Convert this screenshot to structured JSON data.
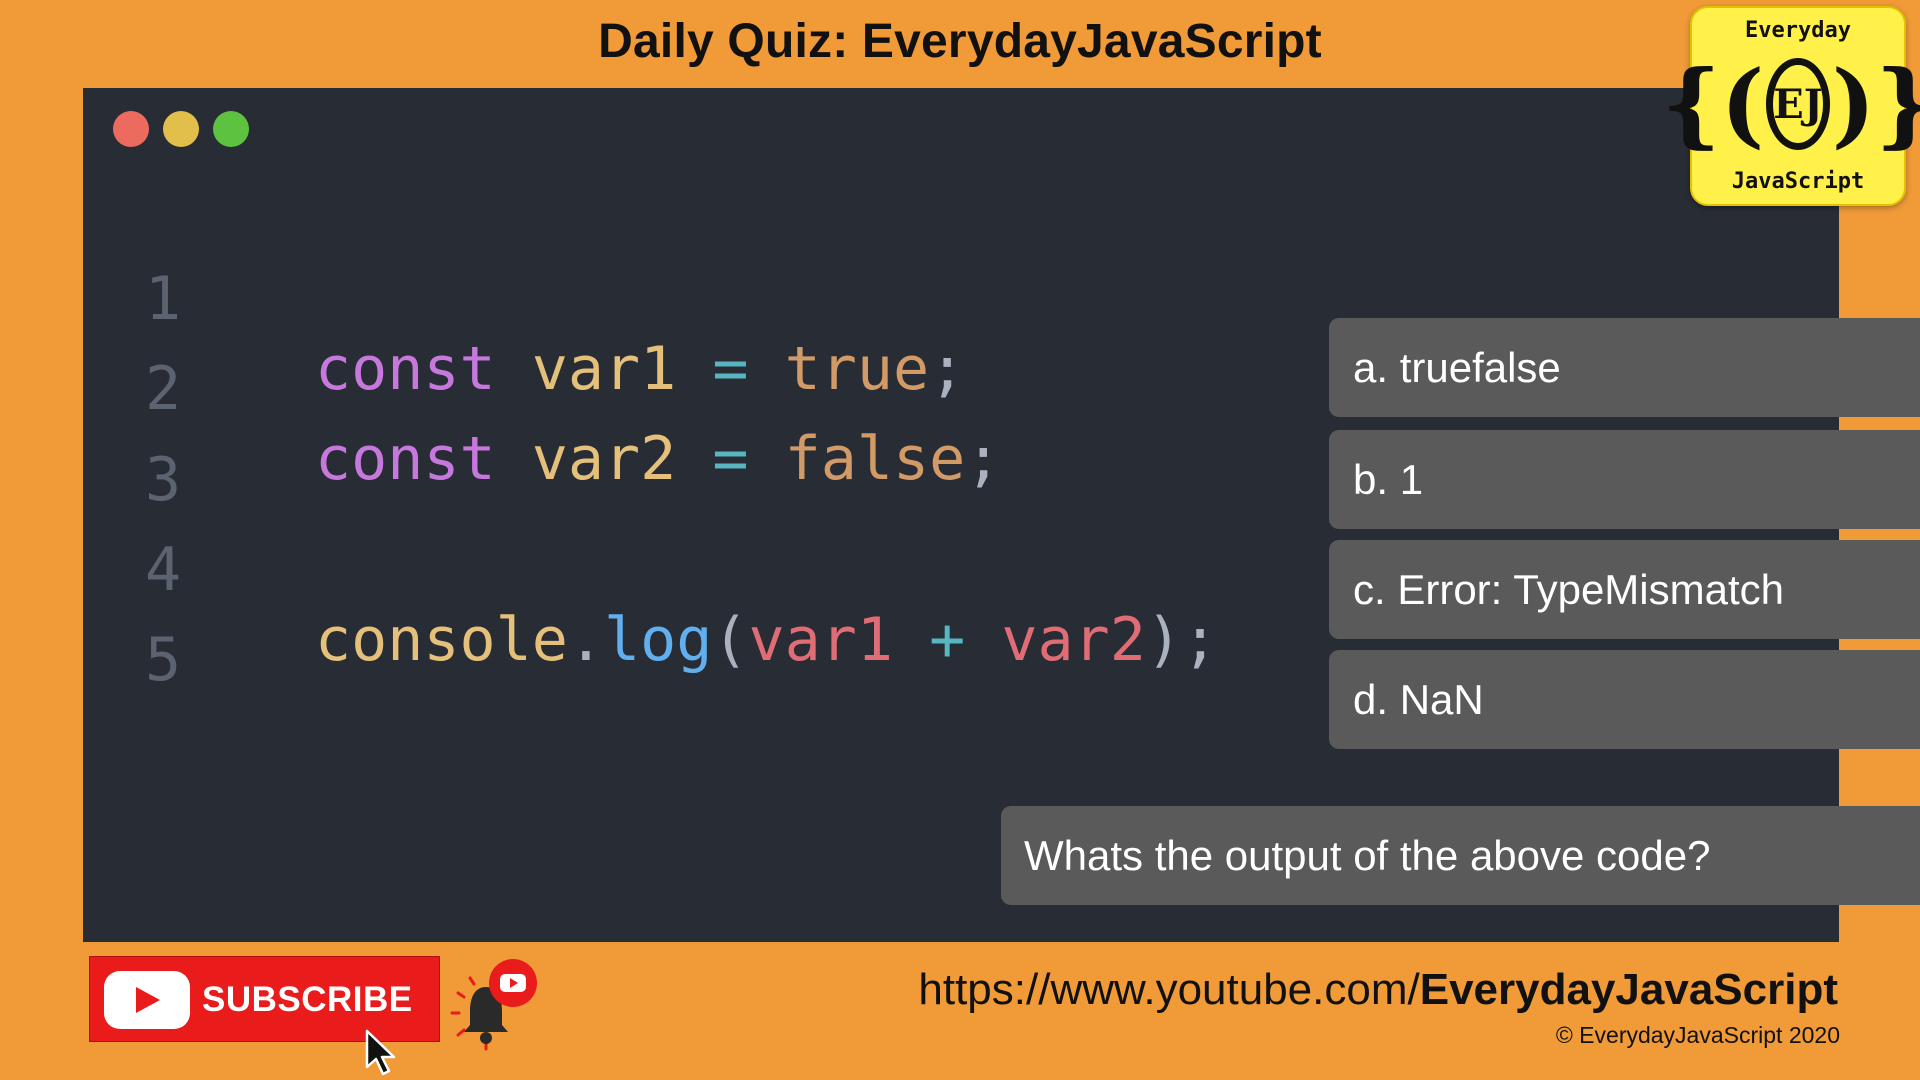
{
  "header": {
    "title": "Daily Quiz: EverydayJavaScript"
  },
  "logo": {
    "top": "Everyday",
    "mark": "EJ",
    "bottom": "JavaScript",
    "open_brace": "{(",
    "close_brace": ")}"
  },
  "code": {
    "line_numbers": [
      "1",
      "2",
      "3",
      "4",
      "5"
    ],
    "line1": {
      "kw": "const",
      "name": "var1",
      "op": "=",
      "value": "true",
      "end": ";"
    },
    "line2": {
      "kw": "const",
      "name": "var2",
      "op": "=",
      "value": "false",
      "end": ";"
    },
    "line4": {
      "obj": "console",
      "dot": ".",
      "fn": "log",
      "open": "(",
      "arg1": "var1",
      "op": "+",
      "arg2": "var2",
      "close": ")",
      "end": ";"
    }
  },
  "quiz": {
    "options": [
      "a. truefalse",
      "b. 1",
      "c. Error: TypeMismatch",
      "d. NaN"
    ],
    "question": "Whats the output of the above code?"
  },
  "footer": {
    "subscribe_label": "SUBSCRIBE",
    "url_prefix": "https://www.youtube.com/",
    "url_channel": "EverydayJavaScript",
    "copyright": "© EverydayJavaScript 2020"
  },
  "colors": {
    "background": "#F09A38",
    "editor_bg": "#282C34",
    "option_bg": "#5A5A5A",
    "subscribe_red": "#E91B1B",
    "logo_yellow": "#FFF04A",
    "keyword": "#C678DD",
    "variable": "#E5C07B",
    "operator": "#56B6C2",
    "boolean": "#D19A66",
    "function": "#61AFEF",
    "argument": "#E06C75"
  },
  "icons": [
    "close-dot",
    "minimize-dot",
    "maximize-dot",
    "youtube-play-icon",
    "cursor-icon",
    "bell-icon",
    "youtube-badge-icon"
  ]
}
